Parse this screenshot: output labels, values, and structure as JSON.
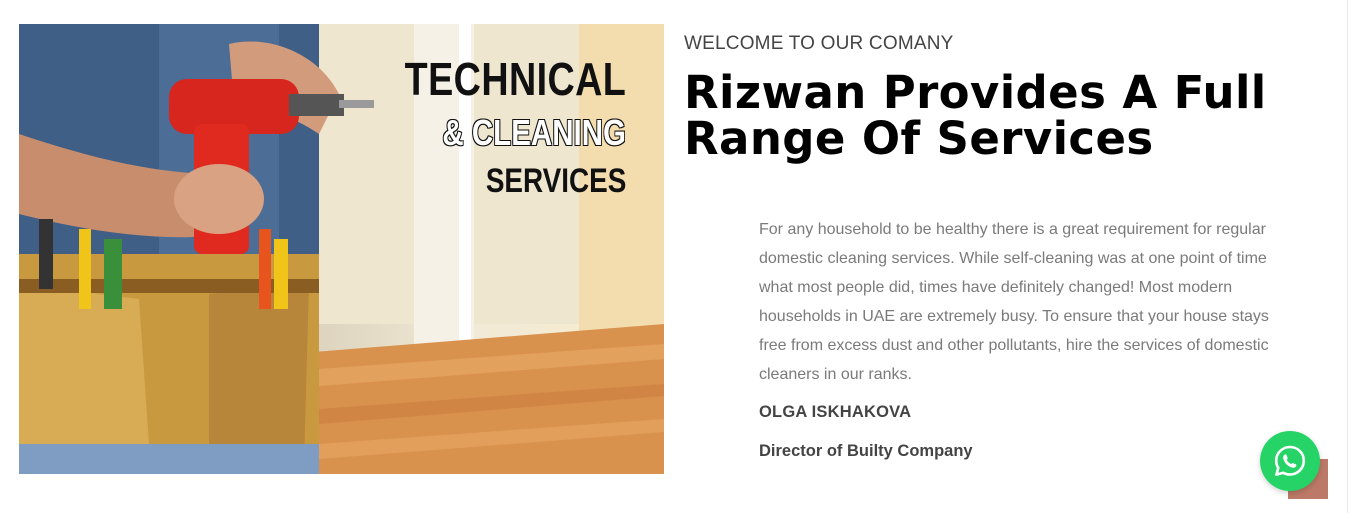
{
  "hero": {
    "line1": "TECHNICAL",
    "line2": "& CLEANING",
    "line3": "SERVICES"
  },
  "intro": {
    "eyebrow": "WELCOME TO OUR COMANY",
    "headline": "Rizwan Provides A Full Range Of Services",
    "body": "For any household to be healthy there is a great requirement for regular domestic cleaning services. While self-cleaning was at one point of time what most people did, times have definitely changed! Most modern households in UAE are extremely busy. To ensure that your house stays free from excess dust and other pollutants, hire the services of domestic cleaners in our ranks.",
    "name": "OLGA ISKHAKOVA",
    "role": "Director of Builty Company"
  },
  "widgets": {
    "whatsapp_icon": "whatsapp-icon",
    "scroll_top_icon": "scroll-top-icon"
  },
  "colors": {
    "whatsapp": "#25d366",
    "scroll_top": "#b56a56",
    "headline": "#000000",
    "body": "#7a7a7a"
  }
}
